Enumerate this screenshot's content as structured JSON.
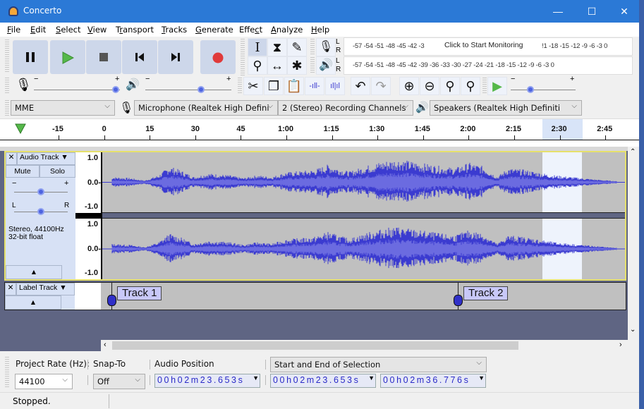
{
  "window": {
    "title": "Concerto",
    "controls": {
      "minimize": "—",
      "maximize": "☐",
      "close": "✕"
    }
  },
  "menu": [
    {
      "label": "File",
      "mnemonic": "F"
    },
    {
      "label": "Edit",
      "mnemonic": "E"
    },
    {
      "label": "Select",
      "mnemonic": "S"
    },
    {
      "label": "View",
      "mnemonic": "V"
    },
    {
      "label": "Transport",
      "mnemonic": "r"
    },
    {
      "label": "Tracks",
      "mnemonic": "T"
    },
    {
      "label": "Generate",
      "mnemonic": "G"
    },
    {
      "label": "Effect",
      "mnemonic": "c"
    },
    {
      "label": "Analyze",
      "mnemonic": "A"
    },
    {
      "label": "Help",
      "mnemonic": "H"
    }
  ],
  "transport": {
    "buttons": [
      "pause",
      "play",
      "stop",
      "skip-to-start",
      "skip-to-end",
      "record"
    ],
    "colors": {
      "play": "#55b84a",
      "record": "#e03a3a",
      "button_bg": "#cdd7ea"
    }
  },
  "tools": [
    "selection",
    "envelope",
    "draw",
    "zoom",
    "time-shift",
    "multi"
  ],
  "meters": {
    "record_scale": "-57 -54 -51 -48 -45 -42 -3",
    "record_scale_tail": "!1 -18 -15 -12  -9   -6   -3   0",
    "record_hint": "Click to Start Monitoring",
    "playback_scale": "-57 -54 -51 -48 -45 -42 -39 -36 -33 -30 -27 -24 -21 -18 -15 -12  -9   -6   -3   0",
    "channel_l": "L",
    "channel_r": "R"
  },
  "mixer": {
    "minus": "−",
    "plus": "+",
    "record_volume": 0.95,
    "playback_volume": 0.65,
    "play_at_speed": 0.3
  },
  "devices": {
    "host": "MME",
    "input": "Microphone (Realtek High Defini",
    "channels": "2 (Stereo) Recording Channels",
    "output": "Speakers (Realtek High Definiti"
  },
  "timeline": {
    "ticks": [
      "-15",
      "0",
      "15",
      "30",
      "45",
      "1:00",
      "1:15",
      "1:30",
      "1:45",
      "2:00",
      "2:15",
      "2:30",
      "2:45"
    ],
    "selection_start": "2:23.653",
    "selection_end": "2:36.776"
  },
  "audio_track": {
    "name": "Audio Track",
    "mute": "Mute",
    "solo": "Solo",
    "gain_minus": "−",
    "gain_plus": "+",
    "pan_l": "L",
    "pan_r": "R",
    "gain": 0.5,
    "pan": 0.5,
    "info_line1": "Stereo, 44100Hz",
    "info_line2": "32-bit float",
    "scale": [
      "1.0",
      "0.0-",
      "-1.0"
    ],
    "wave_color": "#3b3bd0"
  },
  "label_track": {
    "name": "Label Track",
    "labels": [
      {
        "text": "Track 1"
      },
      {
        "text": "Track 2"
      }
    ]
  },
  "selection_toolbar": {
    "project_rate_label": "Project Rate (Hz):",
    "project_rate": "44100",
    "snap_to_label": "Snap-To",
    "snap_to": "Off",
    "audio_position_label": "Audio Position",
    "audio_position": "00h02m23.653s",
    "selection_mode": "Start and End of Selection",
    "selection_start": "00h02m23.653s",
    "selection_end": "00h02m36.776s"
  },
  "status": "Stopped."
}
